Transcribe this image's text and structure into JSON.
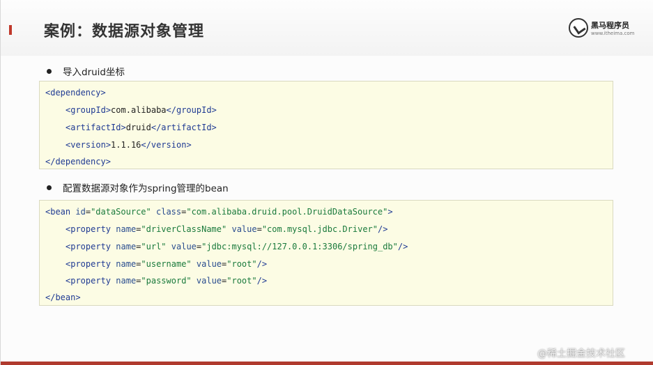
{
  "slide": {
    "title": "案例：数据源对象管理",
    "logo": {
      "name": "黑马程序员",
      "url": "www.itheima.com"
    },
    "bullets": [
      "导入druid坐标",
      "配置数据源对象作为spring管理的bean"
    ],
    "dependency_code": {
      "open_tag": "dependency",
      "group_tag": "groupId",
      "group_value": "com.alibaba",
      "artifact_tag": "artifactId",
      "artifact_value": "druid",
      "version_tag": "version",
      "version_value": "1.1.16"
    },
    "bean_code": {
      "bean_tag": "bean",
      "id_attr": "id",
      "id_value": "\"dataSource\"",
      "class_attr": "class",
      "class_value": "\"com.alibaba.druid.pool.DruidDataSource\"",
      "property_tag": "property",
      "name_attr": "name",
      "value_attr": "value",
      "properties": [
        {
          "name": "\"driverClassName\"",
          "value": "\"com.mysql.jdbc.Driver\""
        },
        {
          "name": "\"url\"",
          "value": "\"jdbc:mysql://127.0.0.1:3306/spring_db\""
        },
        {
          "name": "\"username\"",
          "value": "\"root\""
        },
        {
          "name": "\"password\"",
          "value": "\"root\""
        }
      ]
    }
  },
  "watermark": "@稀土掘金技术社区",
  "colors": {
    "accent": "#c0392b",
    "code_background": "#fcfce4",
    "tag": "#1f3a93",
    "string": "#1a7a3c"
  }
}
